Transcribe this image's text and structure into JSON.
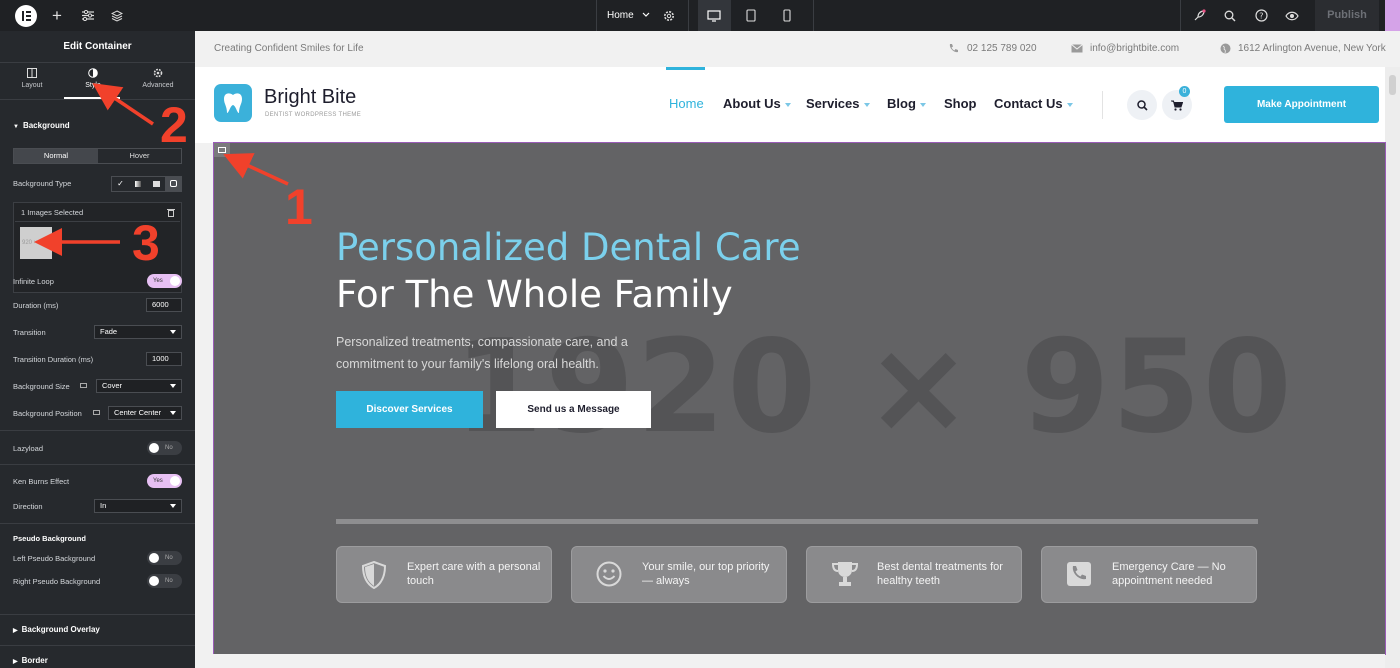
{
  "toolbar": {
    "page_name": "Home",
    "publish_label": "Publish"
  },
  "panel": {
    "title": "Edit Container",
    "tabs": [
      "Layout",
      "Style",
      "Advanced"
    ],
    "section_background": "Background",
    "normal_label": "Normal",
    "hover_label": "Hover",
    "bg_type_label": "Background Type",
    "images_selected": "1 Images Selected",
    "thumb_text": "920 ×",
    "infinite_loop_label": "Infinite Loop",
    "infinite_loop_value": "Yes",
    "duration_label": "Duration (ms)",
    "duration_value": "6000",
    "transition_label": "Transition",
    "transition_value": "Fade",
    "transition_duration_label": "Transition Duration (ms)",
    "transition_duration_value": "1000",
    "bg_size_label": "Background Size",
    "bg_size_value": "Cover",
    "bg_position_label": "Background Position",
    "bg_position_value": "Center Center",
    "lazyload_label": "Lazyload",
    "lazyload_value": "No",
    "ken_burns_label": "Ken Burns Effect",
    "ken_burns_value": "Yes",
    "direction_label": "Direction",
    "direction_value": "In",
    "pseudo_head": "Pseudo Background",
    "left_pseudo_label": "Left Pseudo Background",
    "left_pseudo_value": "No",
    "right_pseudo_label": "Right Pseudo Background",
    "right_pseudo_value": "No",
    "overlay_head": "Background Overlay",
    "border_head": "Border"
  },
  "site": {
    "tagline": "Creating Confident Smiles for Life",
    "phone": "02 125 789 020",
    "email": "info@brightbite.com",
    "address": "1612 Arlington Avenue, New York",
    "brand_name": "Bright Bite",
    "brand_sub": "DENTIST WORDPRESS THEME",
    "nav": [
      "Home",
      "About Us",
      "Services",
      "Blog",
      "Shop",
      "Contact Us"
    ],
    "cart_count": "0",
    "cta_label": "Make Appointment"
  },
  "hero": {
    "dimension_text": "1920 × 950",
    "title_line1": "Personalized Dental Care",
    "title_line2": "For The Whole Family",
    "description": "Personalized treatments, compassionate care, and a commitment to your family's lifelong oral health.",
    "primary_button": "Discover Services",
    "secondary_button": "Send us a Message",
    "features": [
      {
        "text": "Expert care with a personal touch",
        "icon": "shield-icon"
      },
      {
        "text": "Your smile, our top priority — always",
        "icon": "smile-icon"
      },
      {
        "text": "Best dental treatments for healthy teeth",
        "icon": "trophy-icon"
      },
      {
        "text": "Emergency Care — No appointment needed",
        "icon": "phone-icon"
      }
    ]
  },
  "annotations": [
    "1",
    "2",
    "3"
  ],
  "colors": {
    "accent_blue": "#2fb3dc",
    "hero_bg": "#636365",
    "annotation_red": "#f1412b",
    "toggle_on": "#e7c0f3"
  }
}
